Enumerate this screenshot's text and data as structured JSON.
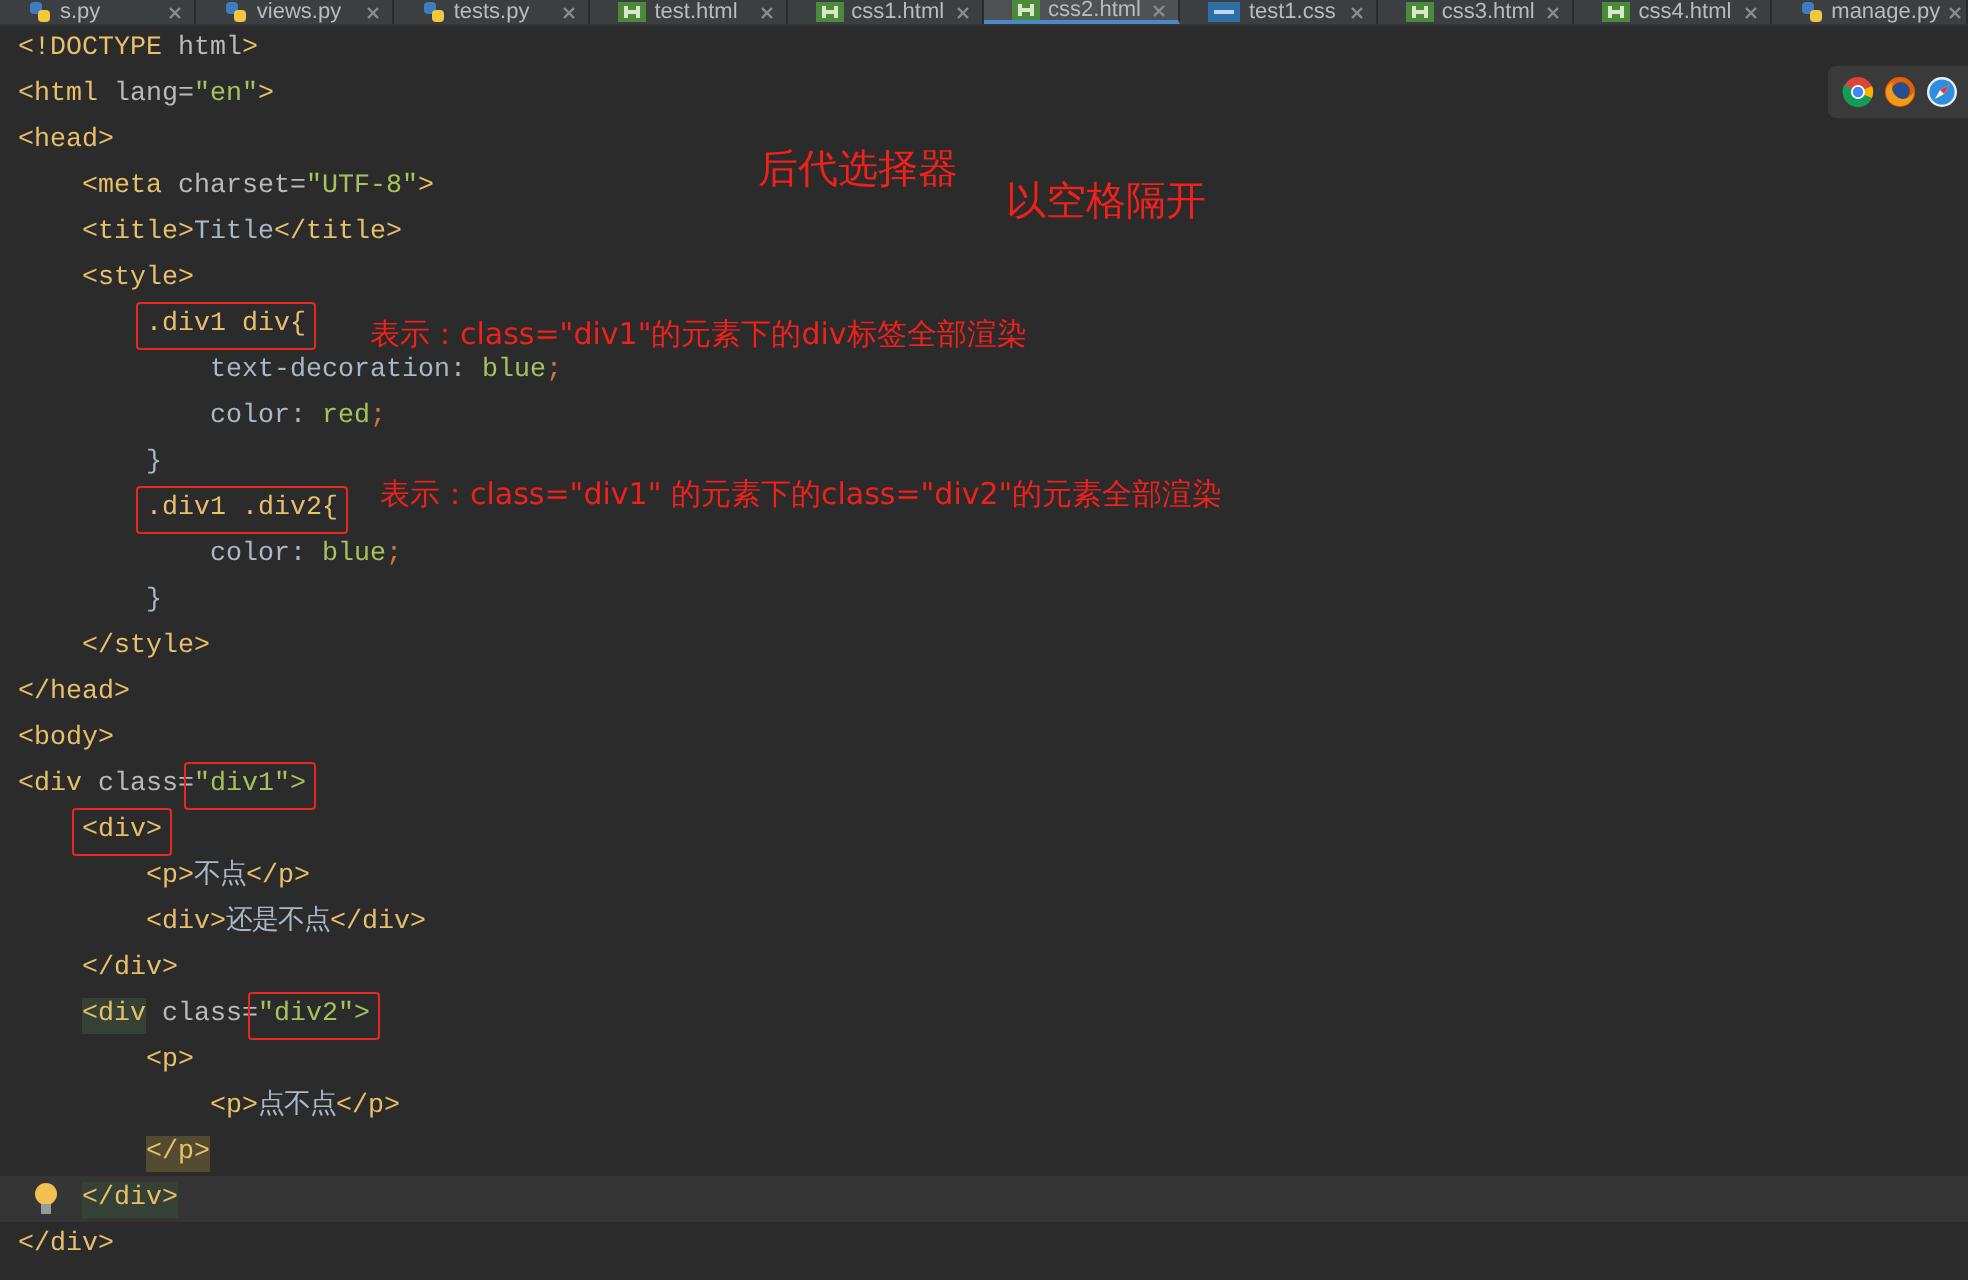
{
  "tabs": [
    {
      "label": "s.py",
      "kind": "py",
      "selected": false
    },
    {
      "label": "views.py",
      "kind": "py",
      "selected": false
    },
    {
      "label": "tests.py",
      "kind": "py",
      "selected": false
    },
    {
      "label": "test.html",
      "kind": "html",
      "selected": false
    },
    {
      "label": "css1.html",
      "kind": "html",
      "selected": false
    },
    {
      "label": "css2.html",
      "kind": "html",
      "selected": true
    },
    {
      "label": "test1.css",
      "kind": "css",
      "selected": false
    },
    {
      "label": "css3.html",
      "kind": "html",
      "selected": false
    },
    {
      "label": "css4.html",
      "kind": "html",
      "selected": false
    },
    {
      "label": "manage.py",
      "kind": "py",
      "selected": false
    }
  ],
  "annotations": [
    "后代选择器",
    "以空格隔开",
    "表示：class=\"div1\"的元素下的div标签全部渲染",
    "表示：class=\"div1\" 的元素下的class=\"div2\"的元素全部渲染"
  ],
  "lines": [
    {
      "current": false,
      "tokens": [
        {
          "kind": "tag",
          "text": "<!DOCTYPE",
          "boxed": false,
          "matched": false,
          "scoped": false
        },
        {
          "kind": "attr",
          "text": " html",
          "boxed": false,
          "matched": false,
          "scoped": false
        },
        {
          "kind": "tag",
          "text": ">",
          "boxed": false,
          "matched": false,
          "scoped": false
        }
      ]
    },
    {
      "current": false,
      "tokens": [
        {
          "kind": "tag",
          "text": "<html",
          "boxed": false,
          "matched": false,
          "scoped": false
        },
        {
          "kind": "attr",
          "text": " lang=",
          "boxed": false,
          "matched": false,
          "scoped": false
        },
        {
          "kind": "string",
          "text": "\"en\"",
          "boxed": false,
          "matched": false,
          "scoped": false
        },
        {
          "kind": "tag",
          "text": ">",
          "boxed": false,
          "matched": false,
          "scoped": false
        }
      ]
    },
    {
      "current": false,
      "tokens": [
        {
          "kind": "tag",
          "text": "<head>",
          "boxed": false,
          "matched": false,
          "scoped": false
        }
      ],
      "children": [
        {
          "current": false,
          "tokens": [
            {
              "kind": "tag",
              "text": "<meta",
              "boxed": false,
              "matched": false,
              "scoped": false
            },
            {
              "kind": "attr",
              "text": " charset=",
              "boxed": false,
              "matched": false,
              "scoped": false
            },
            {
              "kind": "string",
              "text": "\"UTF-8\"",
              "boxed": false,
              "matched": false,
              "scoped": false
            },
            {
              "kind": "tag",
              "text": ">",
              "boxed": false,
              "matched": false,
              "scoped": false
            }
          ]
        },
        {
          "current": false,
          "tokens": [
            {
              "kind": "tag",
              "text": "<title>",
              "boxed": false,
              "matched": false,
              "scoped": false
            },
            {
              "kind": "text",
              "text": "Title",
              "boxed": false,
              "matched": false,
              "scoped": false
            },
            {
              "kind": "tag",
              "text": "</title>",
              "boxed": false,
              "matched": false,
              "scoped": false
            }
          ]
        },
        {
          "current": false,
          "tokens": [
            {
              "kind": "tag",
              "text": "<style>",
              "boxed": false,
              "matched": false,
              "scoped": false
            }
          ],
          "children": [
            {
              "current": false,
              "tokens": [
                {
                  "kind": "tag",
                  "text": ".div1 div{",
                  "boxed": true,
                  "matched": false,
                  "scoped": false
                }
              ],
              "children": [
                {
                  "current": false,
                  "tokens": [
                    {
                      "kind": "text",
                      "text": "text-decoration: ",
                      "boxed": false,
                      "matched": false,
                      "scoped": false
                    },
                    {
                      "kind": "string",
                      "text": "blue",
                      "boxed": false,
                      "matched": false,
                      "scoped": false
                    },
                    {
                      "kind": "punct",
                      "text": ";",
                      "boxed": false,
                      "matched": false,
                      "scoped": false
                    }
                  ]
                },
                {
                  "current": false,
                  "tokens": [
                    {
                      "kind": "text",
                      "text": "color: ",
                      "boxed": false,
                      "matched": false,
                      "scoped": false
                    },
                    {
                      "kind": "string",
                      "text": "red",
                      "boxed": false,
                      "matched": false,
                      "scoped": false
                    },
                    {
                      "kind": "punct",
                      "text": ";",
                      "boxed": false,
                      "matched": false,
                      "scoped": false
                    }
                  ]
                }
              ]
            },
            {
              "current": false,
              "tokens": [
                {
                  "kind": "text",
                  "text": "}",
                  "boxed": false,
                  "matched": false,
                  "scoped": false
                }
              ]
            },
            {
              "current": false,
              "tokens": [
                {
                  "kind": "tag",
                  "text": ".div1 .div2{",
                  "boxed": true,
                  "matched": false,
                  "scoped": false
                }
              ],
              "children": [
                {
                  "current": false,
                  "tokens": [
                    {
                      "kind": "text",
                      "text": "color: ",
                      "boxed": false,
                      "matched": false,
                      "scoped": false
                    },
                    {
                      "kind": "string",
                      "text": "blue",
                      "boxed": false,
                      "matched": false,
                      "scoped": false
                    },
                    {
                      "kind": "punct",
                      "text": ";",
                      "boxed": false,
                      "matched": false,
                      "scoped": false
                    }
                  ]
                }
              ]
            },
            {
              "current": false,
              "tokens": [
                {
                  "kind": "text",
                  "text": "}",
                  "boxed": false,
                  "matched": false,
                  "scoped": false
                }
              ]
            }
          ]
        },
        {
          "current": false,
          "tokens": [
            {
              "kind": "tag",
              "text": "</style>",
              "boxed": false,
              "matched": false,
              "scoped": false
            }
          ]
        }
      ]
    },
    {
      "current": false,
      "tokens": [
        {
          "kind": "tag",
          "text": "</head>",
          "boxed": false,
          "matched": false,
          "scoped": false
        }
      ]
    },
    {
      "current": false,
      "tokens": [
        {
          "kind": "tag",
          "text": "<body>",
          "boxed": false,
          "matched": false,
          "scoped": false
        }
      ]
    },
    {
      "current": false,
      "tokens": [
        {
          "kind": "tag",
          "text": "<div",
          "boxed": false,
          "matched": false,
          "scoped": false
        },
        {
          "kind": "attr",
          "text": " class=",
          "boxed": false,
          "matched": false,
          "scoped": false
        },
        {
          "kind": "string",
          "text": "\"div1\">",
          "boxed": true,
          "matched": false,
          "scoped": false
        }
      ],
      "children": [
        {
          "current": false,
          "tokens": [
            {
              "kind": "tag",
              "text": "<div>",
              "boxed": true,
              "matched": false,
              "scoped": false
            }
          ],
          "children": [
            {
              "current": false,
              "tokens": [
                {
                  "kind": "tag",
                  "text": "<p>",
                  "boxed": false,
                  "matched": false,
                  "scoped": false
                },
                {
                  "kind": "text",
                  "text": "不点",
                  "boxed": false,
                  "matched": false,
                  "scoped": false
                },
                {
                  "kind": "tag",
                  "text": "</p>",
                  "boxed": false,
                  "matched": false,
                  "scoped": false
                }
              ]
            },
            {
              "current": false,
              "tokens": [
                {
                  "kind": "tag",
                  "text": "<div>",
                  "boxed": false,
                  "matched": false,
                  "scoped": false
                },
                {
                  "kind": "text",
                  "text": "还是不点",
                  "boxed": false,
                  "matched": false,
                  "scoped": false
                },
                {
                  "kind": "tag",
                  "text": "</div>",
                  "boxed": false,
                  "matched": false,
                  "scoped": false
                }
              ]
            }
          ]
        },
        {
          "current": false,
          "tokens": [
            {
              "kind": "tag",
              "text": "</div>",
              "boxed": false,
              "matched": false,
              "scoped": false
            }
          ]
        },
        {
          "current": false,
          "tokens": [
            {
              "kind": "tag",
              "text": "<div",
              "boxed": false,
              "matched": true,
              "scoped": false
            },
            {
              "kind": "attr",
              "text": " class=",
              "boxed": false,
              "matched": false,
              "scoped": false
            },
            {
              "kind": "string",
              "text": "\"div2\">",
              "boxed": true,
              "matched": false,
              "scoped": false
            }
          ],
          "children": [
            {
              "current": false,
              "tokens": [
                {
                  "kind": "tag",
                  "text": "<p>",
                  "boxed": false,
                  "matched": false,
                  "scoped": false
                }
              ],
              "children": [
                {
                  "current": false,
                  "tokens": [
                    {
                      "kind": "tag",
                      "text": "<p>",
                      "boxed": false,
                      "matched": false,
                      "scoped": false
                    },
                    {
                      "kind": "text",
                      "text": "点不点",
                      "boxed": false,
                      "matched": false,
                      "scoped": false
                    },
                    {
                      "kind": "tag",
                      "text": "</p>",
                      "boxed": false,
                      "matched": false,
                      "scoped": false
                    }
                  ]
                }
              ]
            },
            {
              "current": false,
              "tokens": [
                {
                  "kind": "tag",
                  "text": "</p>",
                  "boxed": false,
                  "matched": false,
                  "scoped": true
                }
              ]
            }
          ]
        },
        {
          "current": true,
          "tokens": [
            {
              "kind": "tag",
              "text": "</div>",
              "boxed": false,
              "matched": true,
              "scoped": false
            }
          ]
        }
      ]
    },
    {
      "current": false,
      "tokens": [
        {
          "kind": "tag",
          "text": "</div>",
          "boxed": false,
          "matched": false,
          "scoped": false
        }
      ]
    }
  ]
}
